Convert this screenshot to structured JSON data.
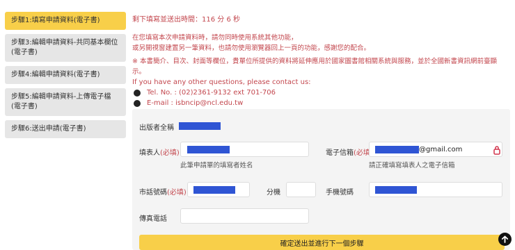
{
  "sidebar": {
    "steps": [
      {
        "label": "步驟1:填寫申請資料(電子書)"
      },
      {
        "label": "步驟3:編輯申請資料-共同基本欄位(電子書)"
      },
      {
        "label": "步驟4:編輯申請資料(電子書)"
      },
      {
        "label": "步驟5:編輯申請資料-上傳電子檔(電子書)"
      },
      {
        "label": "步驟6:送出申請(電子書)"
      }
    ]
  },
  "main": {
    "timer": "剩下填寫並送出時間：116 分 6 秒",
    "notice_line1": "在您填寫本次申請資料時，請勿同時使用系統其他功能，",
    "notice_line2": "或另開視窗建置另一筆資料，也請勿使用瀏覽器回上一頁的功能，感謝您的配合。",
    "notice_line3": "※ 本書簡介、目次、封面等欄位，貴單位所提供的資料將延伸應用於國家圖書館相關系統與服務，並於全國新書資訊網前臺顯",
    "notice_line4": "示。",
    "contact_title": "If you have any other questions, please contact us:",
    "contact_tel": "Tel. No. : (02)2361-9132 ext 701-706",
    "contact_email": "E-mail : isbncip@ncl.edu.tw"
  },
  "form": {
    "publisher_label": "出版者全稱",
    "applicant_label": "填表人",
    "required_text": "(必填)",
    "applicant_hint": "此筆申請單的填寫者姓名",
    "email_label": "電子信箱",
    "email_value": "@gmail.com",
    "email_hint": "請正確填寫填表人之電子信箱",
    "phone_label": "市話號碼",
    "ext_label": "分機",
    "mobile_label": "手機號碼",
    "fax_label": "傳真電話",
    "submit_label": "確定送出並進行下一個步驟"
  },
  "colors": {
    "accent_yellow": "#f8cf49",
    "alert_red": "#c3474e",
    "redaction_blue": "#2f55d4"
  }
}
